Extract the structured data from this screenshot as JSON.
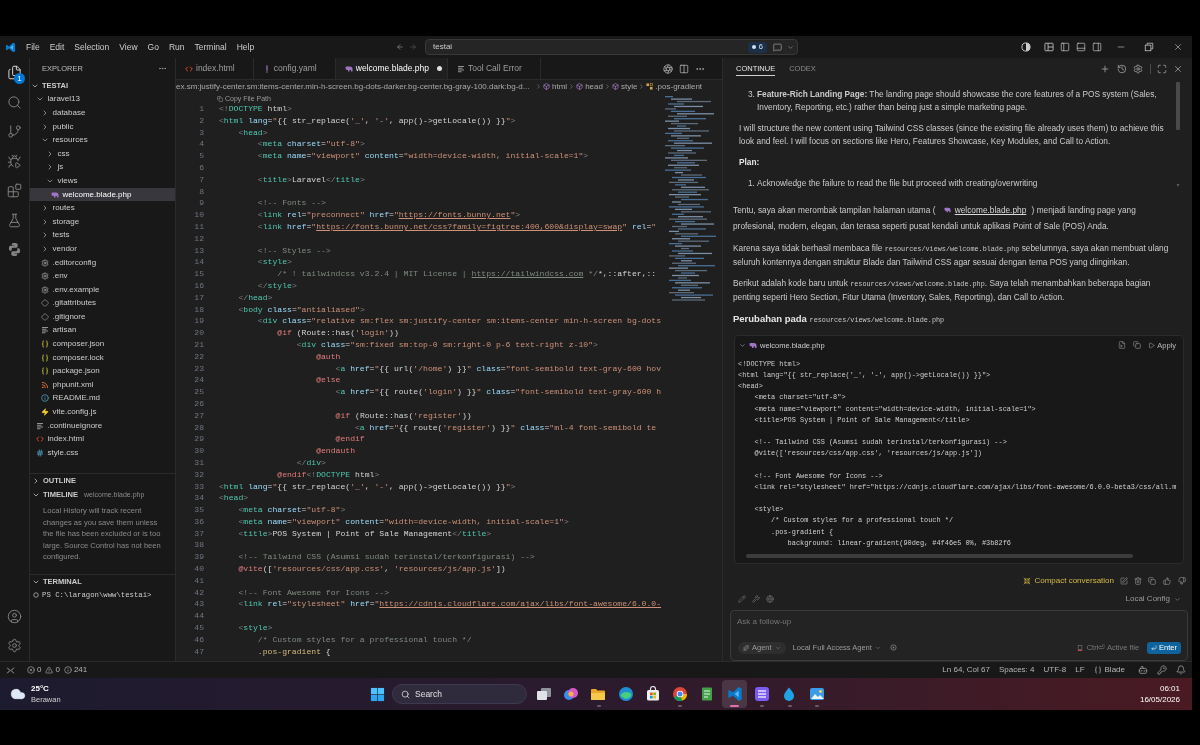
{
  "title_bar": {
    "menu": [
      "File",
      "Edit",
      "Selection",
      "View",
      "Go",
      "Run",
      "Terminal",
      "Help"
    ],
    "search": {
      "value": "testai"
    },
    "badge": "6"
  },
  "activity_bar": {
    "items": [
      {
        "kind": "explorer",
        "selected": true,
        "badge": "1"
      },
      {
        "kind": "search",
        "selected": false
      },
      {
        "kind": "source_control",
        "selected": false
      },
      {
        "kind": "run",
        "selected": false
      },
      {
        "kind": "extensions",
        "selected": false
      },
      {
        "kind": "testing",
        "selected": false
      },
      {
        "kind": "python",
        "selected": false
      }
    ]
  },
  "explorer": {
    "title": "EXPLORER",
    "root": {
      "name": "TESTAI",
      "expanded": true,
      "children": [
        {
          "name": "laravel13",
          "kind": "folder",
          "expanded": true,
          "selected": false,
          "children": [
            {
              "name": "database",
              "kind": "folder",
              "expanded": false,
              "selected": false
            },
            {
              "name": "public",
              "kind": "folder",
              "expanded": false,
              "selected": false
            },
            {
              "name": "resources",
              "kind": "folder",
              "expanded": true,
              "selected": false,
              "children": [
                {
                  "name": "css",
                  "kind": "folder",
                  "expanded": false,
                  "selected": false
                },
                {
                  "name": "js",
                  "kind": "folder",
                  "expanded": false,
                  "selected": false
                },
                {
                  "name": "views",
                  "kind": "folder",
                  "expanded": true,
                  "selected": false,
                  "children": [
                    {
                      "name": "welcome.blade.php",
                      "kind": "blade",
                      "selected": true
                    }
                  ]
                }
              ]
            },
            {
              "name": "routes",
              "kind": "folder",
              "expanded": false,
              "selected": false
            },
            {
              "name": "storage",
              "kind": "folder",
              "expanded": false,
              "selected": false
            },
            {
              "name": "tests",
              "kind": "folder",
              "expanded": false,
              "selected": false
            },
            {
              "name": "vendor",
              "kind": "folder",
              "expanded": false,
              "selected": false
            },
            {
              "name": ".editorconfig",
              "kind": "config",
              "selected": false
            },
            {
              "name": ".env",
              "kind": "config",
              "selected": false
            },
            {
              "name": ".env.example",
              "kind": "config",
              "selected": false
            },
            {
              "name": ".gitattributes",
              "kind": "git",
              "selected": false
            },
            {
              "name": ".gitignore",
              "kind": "git",
              "selected": false
            },
            {
              "name": "artisan",
              "kind": "text",
              "selected": false
            },
            {
              "name": "composer.json",
              "kind": "json",
              "selected": false
            },
            {
              "name": "composer.lock",
              "kind": "json",
              "selected": false
            },
            {
              "name": "package.json",
              "kind": "json",
              "selected": false
            },
            {
              "name": "phpunit.xml",
              "kind": "xml",
              "selected": false
            },
            {
              "name": "README.md",
              "kind": "info",
              "selected": false
            },
            {
              "name": "vite.config.js",
              "kind": "vite",
              "selected": false
            }
          ]
        },
        {
          "name": ".continueignore",
          "kind": "text",
          "selected": false
        },
        {
          "name": "index.html",
          "kind": "html",
          "selected": false
        },
        {
          "name": "style.css",
          "kind": "css",
          "selected": false
        }
      ]
    },
    "sections": [
      {
        "title": "OUTLINE",
        "expanded": false
      },
      {
        "title": "TIMELINE",
        "expanded": true,
        "subtitle": "welcome.blade.php",
        "message": "Local History will track recent changes as you save them unless the file has been excluded or is too large. Source Control has not been configured."
      }
    ],
    "terminal": {
      "title": "TERMINAL",
      "expanded": true,
      "prompt": "PS C:\\laragon\\www\\testai>"
    }
  },
  "editor": {
    "tabs": [
      {
        "label": "index.html",
        "kind": "html",
        "selected": false,
        "modified": false
      },
      {
        "label": "config.yaml",
        "kind": "yaml",
        "selected": false,
        "modified": false
      },
      {
        "label": "welcome.blade.php",
        "kind": "blade",
        "selected": true,
        "modified": true
      },
      {
        "label": "Tool Call Error",
        "kind": "tool",
        "selected": false,
        "modified": false
      }
    ],
    "breadcrumbs": [
      {
        "label": "ex.sm:justify-center.sm:items-center.min-h-screen.bg-dots-darker.bg-center.bg-gray-100.dark:bg-d...",
        "kind": "text"
      },
      {
        "label": "html",
        "kind": "element"
      },
      {
        "label": "head",
        "kind": "element"
      },
      {
        "label": "style",
        "kind": "element"
      },
      {
        "label": ".pos-gradient",
        "kind": "selector"
      }
    ],
    "hover_label": "Copy File Path",
    "lines": [
      {
        "n": "1",
        "code": "<!DOCTYPE html>"
      },
      {
        "n": "2",
        "code": "<html lang=\"{{ str_replace('_', '-', app()->getLocale()) }}\">"
      },
      {
        "n": "3",
        "code": "    <head>"
      },
      {
        "n": "4",
        "code": "        <meta charset=\"utf-8\">"
      },
      {
        "n": "5",
        "code": "        <meta name=\"viewport\" content=\"width=device-width, initial-scale=1\">"
      },
      {
        "n": "6"
      },
      {
        "n": "7",
        "code": "        <title>Laravel</title>"
      },
      {
        "n": "8"
      },
      {
        "n": "9",
        "code": "        <!-- Fonts -->"
      },
      {
        "n": "10",
        "code": "        <link rel=\"preconnect\" href=\"https://fonts.bunny.net\">"
      },
      {
        "n": "11",
        "code": "        <link href=\"https://fonts.bunny.net/css?family=figtree:400,600&display=swap\" rel=\""
      },
      {
        "n": "12"
      },
      {
        "n": "13",
        "code": "        <!-- Styles -->"
      },
      {
        "n": "14",
        "code": "        <style>"
      },
      {
        "n": "15",
        "code": "            /* ! tailwindcss v3.2.4 | MIT License | https://tailwindcss.com */*,::after,::"
      },
      {
        "n": "16",
        "code": "        </style>"
      },
      {
        "n": "17",
        "code": "    </head>"
      },
      {
        "n": "18",
        "code": "    <body class=\"antialiased\">"
      },
      {
        "n": "19",
        "code": "        <div class=\"relative sm:flex sm:justify-center sm:items-center min-h-screen bg-dots"
      },
      {
        "n": "20",
        "code": "            @if (Route::has('login'))"
      },
      {
        "n": "21",
        "code": "                <div class=\"sm:fixed sm:top-0 sm:right-0 p-6 text-right z-10\">"
      },
      {
        "n": "22",
        "code": "                    @auth"
      },
      {
        "n": "23",
        "code": "                        <a href=\"{{ url('/home') }}\" class=\"font-semibold text-gray-600 hov"
      },
      {
        "n": "24",
        "code": "                    @else"
      },
      {
        "n": "25",
        "code": "                        <a href=\"{{ route('login') }}\" class=\"font-semibold text-gray-600 h"
      },
      {
        "n": "26"
      },
      {
        "n": "27",
        "code": "                        @if (Route::has('register'))"
      },
      {
        "n": "28",
        "code": "                            <a href=\"{{ route('register') }}\" class=\"ml-4 font-semibold te"
      },
      {
        "n": "29",
        "code": "                        @endif"
      },
      {
        "n": "30",
        "code": "                    @endauth"
      },
      {
        "n": "31",
        "code": "                </div>"
      },
      {
        "n": "32",
        "code": "            @endif<!DOCTYPE html>"
      },
      {
        "n": "33",
        "code": "<html lang=\"{{ str_replace('_', '-', app()->getLocale()) }}\">"
      },
      {
        "n": "34",
        "code": "<head>"
      },
      {
        "n": "35",
        "code": "    <meta charset=\"utf-8\">"
      },
      {
        "n": "36",
        "code": "    <meta name=\"viewport\" content=\"width=device-width, initial-scale=1\">"
      },
      {
        "n": "37",
        "code": "    <title>POS System | Point of Sale Management</title>"
      },
      {
        "n": "38"
      },
      {
        "n": "39",
        "code": "    <!-- Tailwind CSS (Asumsi sudah terinstal/terkonfigurasi) -->"
      },
      {
        "n": "40",
        "code": "    @vite(['resources/css/app.css', 'resources/js/app.js'])"
      },
      {
        "n": "41"
      },
      {
        "n": "42",
        "code": "    <!-- Font Awesome for Icons -->"
      },
      {
        "n": "43",
        "code": "    <link rel=\"stylesheet\" href=\"https://cdnjs.cloudflare.com/ajax/libs/font-awesome/6.0.0-"
      },
      {
        "n": "44"
      },
      {
        "n": "45",
        "code": "    <style>"
      },
      {
        "n": "46",
        "code": "        /* Custom styles for a professional touch */"
      },
      {
        "n": "47",
        "code": "        .pos-gradient {"
      }
    ]
  },
  "chat": {
    "tabs": [
      {
        "label": "CONTINUE",
        "selected": true
      },
      {
        "label": "CODEX",
        "selected": false
      }
    ],
    "reasoning": [
      {
        "kind": "list-item",
        "marker": "3.",
        "text": "**Feature-Rich Landing Page:** The landing page should showcase the core features of a POS system (Sales, Inventory, Reporting, etc.) rather than being just a simple marketing page."
      },
      {
        "kind": "paragraph",
        "text": "I will structure the new content using Tailwind CSS classes (since the existing file already uses them) to achieve this look and feel. I will focus on sections like Hero, Features Showcase, Key Modules, and Call to Action."
      },
      {
        "kind": "label",
        "text": "Plan:"
      },
      {
        "kind": "list-item",
        "marker": "1.",
        "text": "Acknowledge the failure to read the file but proceed with creating/overwriting"
      }
    ],
    "response": [
      {
        "kind": "paragraph",
        "segments": [
          {
            "kind": "text",
            "text": "Tentu, saya akan merombak tampilan halaman utama ( "
          },
          {
            "kind": "file",
            "text": "welcome.blade.php"
          },
          {
            "kind": "text",
            "text": " ) menjadi landing page yang profesional, modern, elegan, dan terasa seperti pusat kendali untuk aplikasi Point of Sale (POS) Anda."
          }
        ]
      },
      {
        "kind": "paragraph",
        "segments": [
          {
            "kind": "text",
            "text": "Karena saya tidak berhasil membaca file "
          },
          {
            "kind": "code",
            "text": "resources/views/welcome.blade.php"
          },
          {
            "kind": "text",
            "text": " sebelumnya, saya akan membuat ulang seluruh kontennya dengan struktur Blade dan Tailwind CSS agar sesuai dengan tema POS yang diinginkan."
          }
        ]
      },
      {
        "kind": "paragraph",
        "segments": [
          {
            "kind": "text",
            "text": "Berikut adalah kode baru untuk "
          },
          {
            "kind": "code",
            "text": "resources/views/welcome.blade.php"
          },
          {
            "kind": "text",
            "text": ". Saya telah menambahkan beberapa bagian penting seperti Hero Section, Fitur Utama (Inventory, Sales, Reporting), dan Call to Action."
          }
        ]
      },
      {
        "kind": "heading",
        "segments": [
          {
            "kind": "text",
            "text": "Perubahan pada "
          },
          {
            "kind": "code",
            "text": "resources/views/welcome.blade.php"
          }
        ]
      }
    ],
    "code_block": {
      "expanded": true,
      "filename": "welcome.blade.php",
      "action": "Apply",
      "chunks": [
        [
          "<!DOCTYPE html>",
          "<html lang=\"{{ str_replace('_', '-', app()->getLocale()) }}\">",
          "<head>",
          "    <meta charset=\"utf-8\">",
          "    <meta name=\"viewport\" content=\"width=device-width, initial-scale=1\">",
          "    <title>POS System | Point of Sale Management</title>"
        ],
        [
          "    <!-- Tailwind CSS (Asumsi sudah terinstal/terkonfigurasi) -->",
          "    @vite(['resources/css/app.css', 'resources/js/app.js'])"
        ],
        [
          "    <!-- Font Awesome for Icons -->",
          "    <link rel=\"stylesheet\" href=\"https://cdnjs.cloudflare.com/ajax/libs/font-awesome/6.0.0-beta3/css/all.m"
        ],
        [
          "    <style>",
          "        /* Custom styles for a professional touch */",
          "        .pos-gradient {",
          "            background: linear-gradient(90deg, #4f46e5 0%, #3b82f6"
        ]
      ]
    },
    "compact": "Compact conversation",
    "config": "Local Config",
    "input": {
      "placeholder": "Ask a follow-up",
      "mode": "Agent",
      "agent": "Local Full Access Agent",
      "context_hint": "Ctrl⏎ Active file",
      "submit": "Enter"
    }
  },
  "status_bar": {
    "problems": {
      "errors": "0",
      "warnings": "0",
      "infos": "241"
    },
    "items": [
      {
        "label": "Ln 64, Col 67",
        "kind": "text"
      },
      {
        "label": "Spaces: 4",
        "kind": "text"
      },
      {
        "label": "UTF-8",
        "kind": "text"
      },
      {
        "label": "LF",
        "kind": "text"
      },
      {
        "label": "Blade",
        "kind": "language"
      }
    ]
  },
  "taskbar": {
    "weather": {
      "temperature": "25°C",
      "condition": "Berawan"
    },
    "search": {
      "placeholder": "Search"
    },
    "apps": [
      {
        "kind": "taskview",
        "running": false,
        "active": false
      },
      {
        "kind": "assistant",
        "running": false,
        "active": false
      },
      {
        "kind": "folder",
        "running": true,
        "active": false
      },
      {
        "kind": "wave",
        "running": false,
        "active": false
      },
      {
        "kind": "store",
        "running": false,
        "active": false
      },
      {
        "kind": "ring",
        "running": true,
        "active": false
      },
      {
        "kind": "notepad",
        "running": false,
        "active": false
      },
      {
        "kind": "editor",
        "running": true,
        "active": true
      },
      {
        "kind": "stripes",
        "running": true,
        "active": false
      },
      {
        "kind": "drop",
        "running": true,
        "active": false
      },
      {
        "kind": "photos",
        "running": true,
        "active": false
      }
    ],
    "clock": {
      "time": "06:01",
      "date": "16/05/2026"
    }
  }
}
